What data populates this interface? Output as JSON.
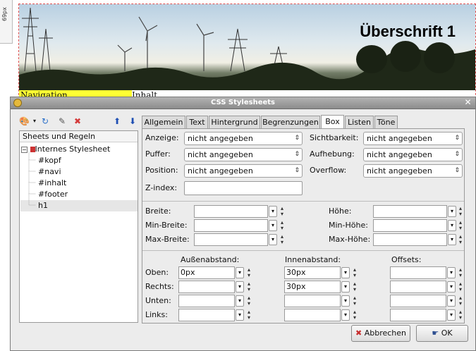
{
  "ruler_label": "69px",
  "page": {
    "heading": "Überschrift 1",
    "nav_cell": "Navigation",
    "content_cell": "Inhalt"
  },
  "dialog": {
    "title": "CSS Stylesheets",
    "close_glyph": "✕",
    "toolbar": {
      "new_icon": "🎨",
      "refresh_icon": "↻",
      "edit_icon": "✎",
      "delete_icon": "✖",
      "up_icon": "⬆",
      "down_icon": "⬇"
    },
    "tree": {
      "header": "Sheets und Regeln",
      "root": "Internes Stylesheet",
      "rules": [
        "#kopf",
        "#navi",
        "#inhalt",
        "#footer",
        "h1"
      ],
      "selected": "h1"
    },
    "tabs": [
      "Allgemein",
      "Text",
      "Hintergrund",
      "Begrenzungen",
      "Box",
      "Listen",
      "Töne"
    ],
    "active_tab": "Box",
    "box": {
      "anzeige_label": "Anzeige:",
      "anzeige_value": "nicht angegeben",
      "sichtbarkeit_label": "Sichtbarkeit:",
      "sichtbarkeit_value": "nicht angegeben",
      "puffer_label": "Puffer:",
      "puffer_value": "nicht angegeben",
      "aufhebung_label": "Aufhebung:",
      "aufhebung_value": "nicht angegeben",
      "position_label": "Position:",
      "position_value": "nicht angegeben",
      "overflow_label": "Overflow:",
      "overflow_value": "nicht angegeben",
      "zindex_label": "Z-index:",
      "zindex_value": "",
      "breite_label": "Breite:",
      "hoehe_label": "Höhe:",
      "minbreite_label": "Min-Breite:",
      "minhoehe_label": "Min-Höhe:",
      "maxbreite_label": "Max-Breite:",
      "maxhoehe_label": "Max-Höhe:",
      "aussen_header": "Außenabstand:",
      "innen_header": "Innenabstand:",
      "offsets_header": "Offsets:",
      "oben_label": "Oben:",
      "rechts_label": "Rechts:",
      "unten_label": "Unten:",
      "links_label": "Links:",
      "aussen_oben": "0px",
      "aussen_rechts": "",
      "aussen_unten": "",
      "aussen_links": "",
      "innen_oben": "30px",
      "innen_rechts": "30px",
      "innen_unten": "",
      "innen_links": "",
      "offset_oben": "",
      "offset_rechts": "",
      "offset_unten": "",
      "offset_links": ""
    },
    "buttons": {
      "cancel": "Abbrechen",
      "ok": "OK",
      "cancel_icon": "✖",
      "ok_icon": "☛"
    }
  }
}
